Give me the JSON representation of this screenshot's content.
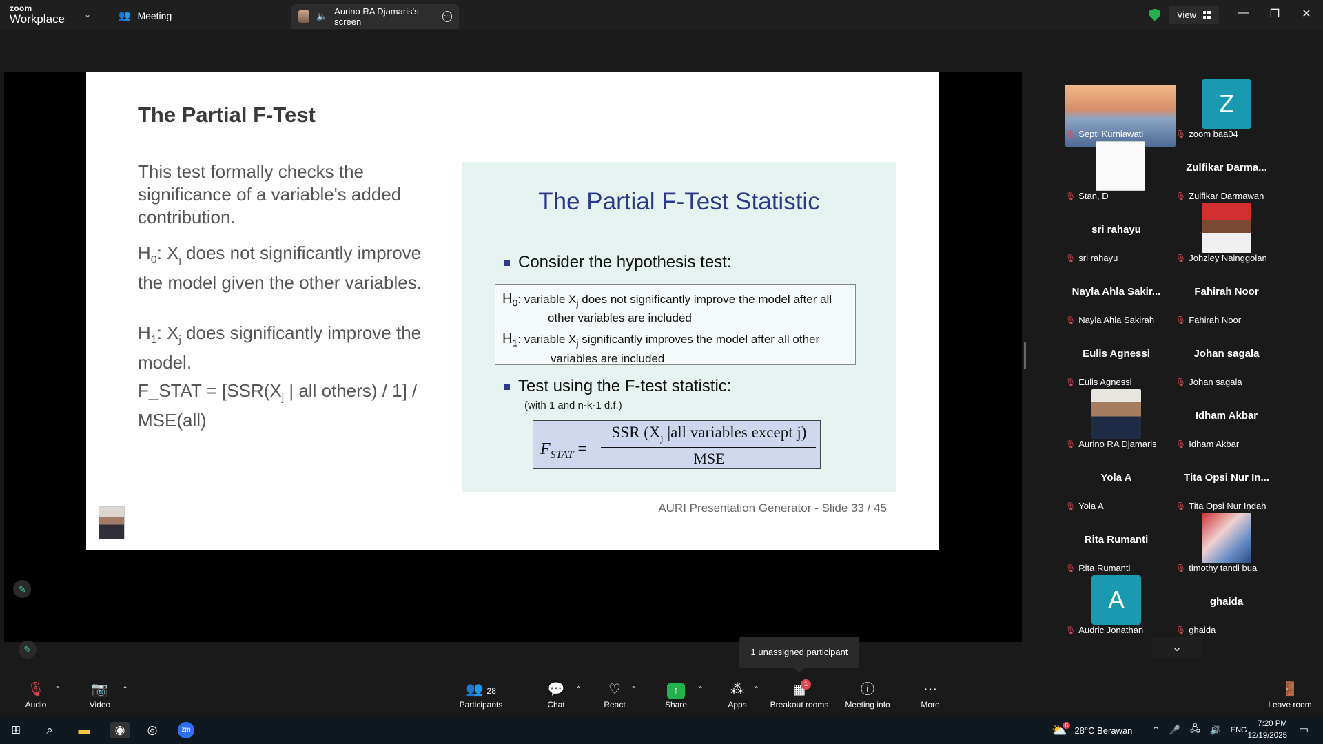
{
  "titlebar": {
    "brand_top": "zoom",
    "brand_bottom": "Workplace",
    "meeting_label": "Meeting",
    "screen_tab": "Aurino RA Djamaris's screen",
    "view_label": "View",
    "minimize": "—",
    "maximize": "❐",
    "close": "✕"
  },
  "slide": {
    "title": "The Partial F-Test",
    "para1": "This test formally checks the significance of a variable's added contribution.",
    "para2_prefix": "H",
    "para2_sub0": "0",
    "para2_x": ": X",
    "para2_subj": "j",
    "para2_rest": " does not significantly improve the model given the other variables.",
    "para3_prefix": "H",
    "para3_sub1": "1",
    "para3_x": ": X",
    "para3_subj": "j",
    "para3_rest": " does significantly improve the model.",
    "para4_a": "F_STAT = [SSR(X",
    "para4_subj": "j",
    "para4_b": " | all others) / 1] / MSE(all)",
    "inner_title": "The Partial F-Test Statistic",
    "bullet1": "Consider the hypothesis test:",
    "h0_label": "H",
    "h0_sub": "0",
    "h0_text": ": variable X",
    "h0_subj": "j",
    "h0_rest": " does not significantly improve the model after all",
    "h0_line2": "other  variables are included",
    "h1_label": "H",
    "h1_sub": "1",
    "h1_text": ": variable X",
    "h1_subj": "j",
    "h1_rest": " significantly improves the model after all other",
    "h1_line2": "variables are included",
    "bullet2": "Test using the F-test statistic:",
    "df_note": "(with 1 and n-k-1 d.f.)",
    "formula_lhs": "F",
    "formula_lhs_sub": "STAT",
    "formula_eq": " =",
    "formula_num_a": "SSR (X",
    "formula_num_subj": "j",
    "formula_num_b": " |all variables except j)",
    "formula_den": "MSE",
    "footer": "AURI Presentation Generator - Slide 33 / 45"
  },
  "participants": [
    {
      "label": "Septi Kurniawati",
      "big": "",
      "kind": "photo-bridge"
    },
    {
      "label": "zoom baa04",
      "big": "",
      "kind": "letter",
      "letter": "Z"
    },
    {
      "label": "Stan, D",
      "big": "",
      "kind": "photo-doc"
    },
    {
      "label": "Zulfikar Darmawan",
      "big": "Zulfikar  Darma...",
      "kind": "name"
    },
    {
      "label": "sri rahayu",
      "big": "sri rahayu",
      "kind": "name"
    },
    {
      "label": "Johzley Nainggolan",
      "big": "",
      "kind": "photo-red"
    },
    {
      "label": "Nayla Ahla Sakirah",
      "big": "Nayla  Ahla  Sakir...",
      "kind": "name"
    },
    {
      "label": "Fahirah Noor",
      "big": "Fahirah Noor",
      "kind": "name"
    },
    {
      "label": "Eulis Agnessi",
      "big": "Eulis Agnessi",
      "kind": "name"
    },
    {
      "label": "Johan sagala",
      "big": "Johan sagala",
      "kind": "name"
    },
    {
      "label": "Aurino RA Djamaris",
      "big": "",
      "kind": "photo-man"
    },
    {
      "label": "Idham Akbar",
      "big": "Idham Akbar",
      "kind": "name"
    },
    {
      "label": "Yola A",
      "big": "Yola A",
      "kind": "name"
    },
    {
      "label": "Tita Opsi Nur Indah",
      "big": "Tita Opsi Nur In...",
      "kind": "name"
    },
    {
      "label": "Rita Rumanti",
      "big": "Rita Rumanti",
      "kind": "name"
    },
    {
      "label": "timothy tandi bua",
      "big": "",
      "kind": "photo-group"
    },
    {
      "label": "Audric Jonathan",
      "big": "",
      "kind": "letter",
      "letter": "A"
    },
    {
      "label": "ghaida",
      "big": "ghaida",
      "kind": "name"
    }
  ],
  "tooltip": "1 unassigned participant",
  "toolbar": {
    "audio": "Audio",
    "video": "Video",
    "participants": "Participants",
    "participants_count": "28",
    "chat": "Chat",
    "react": "React",
    "share": "Share",
    "apps": "Apps",
    "breakout": "Breakout rooms",
    "breakout_badge": "1",
    "meeting_info": "Meeting info",
    "more": "More",
    "leave": "Leave room"
  },
  "taskbar": {
    "weather_badge": "6",
    "weather": "28°C  Berawan",
    "lang": "ENG",
    "time": "7:20 PM",
    "date": "12/19/2025"
  },
  "colors": {
    "accent_green": "#23b14d",
    "mic_off_red": "#e0464e",
    "letter_avatar": "#1a9ab0",
    "slide_title_blue": "#2c3a8c"
  }
}
